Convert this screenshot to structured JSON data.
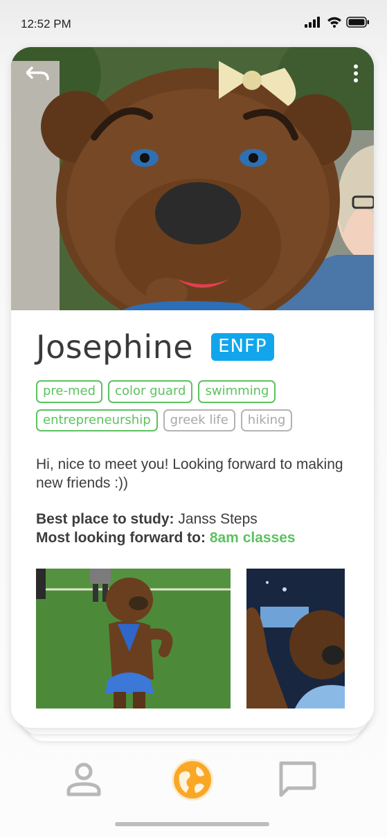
{
  "status_bar": {
    "time": "12:52 PM",
    "icons": [
      "cellular-signal-icon",
      "wifi-icon",
      "battery-icon"
    ]
  },
  "card": {
    "top_actions": [
      "undo-icon",
      "more-vertical-icon"
    ],
    "name": "Josephine",
    "personality_type": "ENFP",
    "tags": [
      {
        "label": "pre-med",
        "active": true
      },
      {
        "label": "color guard",
        "active": true
      },
      {
        "label": "swimming",
        "active": true
      },
      {
        "label": "entrepreneurship",
        "active": true
      },
      {
        "label": "greek life",
        "active": false
      },
      {
        "label": "hiking",
        "active": false
      }
    ],
    "bio": "Hi, nice to meet you! Looking forward to making new friends :))",
    "prompts": [
      {
        "label": "Best place to study:",
        "value": "Janss Steps",
        "highlight": false
      },
      {
        "label": "Most looking forward to:",
        "value": "8am classes",
        "highlight": true
      }
    ]
  },
  "bottom_nav": {
    "items": [
      {
        "icon": "profile-icon",
        "active": false
      },
      {
        "icon": "globe-icon",
        "active": true
      },
      {
        "icon": "chat-icon",
        "active": false
      }
    ]
  },
  "colors": {
    "accent_blue": "#11a6ec",
    "tag_green": "#5cc25f",
    "tag_grey": "#b3b3b3",
    "nav_active": "#f9a826",
    "nav_inactive": "#b8b8b8"
  }
}
